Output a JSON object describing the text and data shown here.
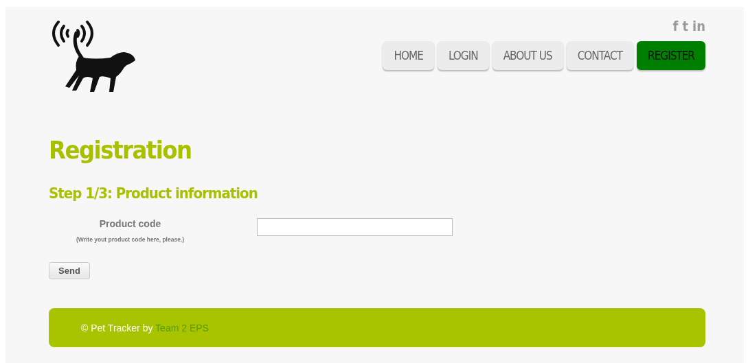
{
  "social": [
    "f",
    "t",
    "in"
  ],
  "nav": [
    {
      "label": "HOME",
      "selected": false
    },
    {
      "label": "LOGIN",
      "selected": false
    },
    {
      "label": "ABOUT US",
      "selected": false
    },
    {
      "label": "CONTACT",
      "selected": false
    },
    {
      "label": "REGISTER",
      "selected": true
    }
  ],
  "title": "Registration",
  "step": "Step 1/3: Product information",
  "form": {
    "label": "Product code",
    "hint": "(Write yout product code here, please.)",
    "button": "Send"
  },
  "footer": {
    "text": "© Pet Tracker by ",
    "link": "Team 2 EPS"
  }
}
